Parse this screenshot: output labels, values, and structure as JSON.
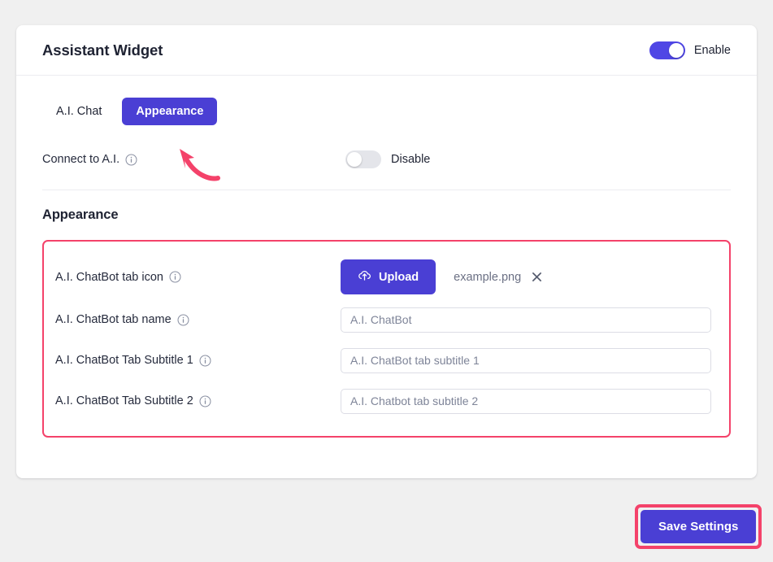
{
  "card": {
    "title": "Assistant Widget",
    "header_toggle": {
      "state": "on",
      "label": "Enable"
    }
  },
  "tabs": [
    {
      "label": "A.I. Chat",
      "active": false
    },
    {
      "label": "Appearance",
      "active": true
    }
  ],
  "connect_row": {
    "label": "Connect to A.I.",
    "info_icon": "info-icon",
    "toggle": {
      "state": "off",
      "label": "Disable"
    }
  },
  "appearance": {
    "heading": "Appearance",
    "fields": [
      {
        "label": "A.I. ChatBot tab icon",
        "info_icon": "info-icon",
        "control": "upload",
        "upload_label": "Upload",
        "upload_icon": "cloud-upload-icon",
        "file_name": "example.png",
        "remove_icon": "close-icon"
      },
      {
        "label": "A.I. ChatBot tab name",
        "info_icon": "info-icon",
        "control": "text",
        "value": "",
        "placeholder": "A.I. ChatBot"
      },
      {
        "label": "A.I. ChatBot Tab Subtitle 1",
        "info_icon": "info-icon",
        "control": "text",
        "value": "",
        "placeholder": "A.I. ChatBot tab subtitle 1"
      },
      {
        "label": "A.I. ChatBot Tab Subtitle 2",
        "info_icon": "info-icon",
        "control": "text",
        "value": "",
        "placeholder": "A.I. Chatbot tab subtitle 2"
      }
    ]
  },
  "footer": {
    "save_label": "Save Settings"
  },
  "annotations": {
    "arrow_target": "Appearance",
    "highlight_color": "#f4426a"
  },
  "colors": {
    "accent_purple": "#4a3fd4",
    "toggle_on": "#4f46e5",
    "annotation_red": "#f4426a",
    "page_background": "#f0f0f0",
    "card_background": "#ffffff"
  }
}
